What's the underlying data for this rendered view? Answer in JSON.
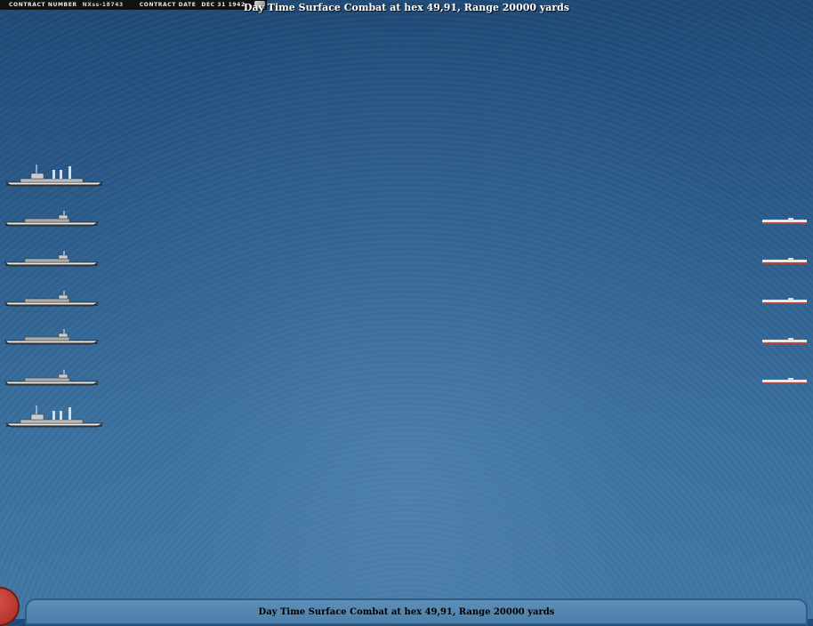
{
  "header": {
    "contract_number_label": "CONTRACT NUMBER",
    "contract_number_value": "NXss-18743",
    "contract_date_label": "CONTRACT DATE",
    "contract_date_value": "DEC 31 1942"
  },
  "combat": {
    "title": "Day Time Surface Combat at hex 49,91, Range 20000 yards"
  },
  "status_bar": {
    "text": "Day Time Surface Combat at hex 49,91, Range 20000 yards"
  },
  "allied_ships": [
    {
      "class": "cruiser"
    },
    {
      "class": "destroyer"
    },
    {
      "class": "destroyer"
    },
    {
      "class": "destroyer"
    },
    {
      "class": "destroyer"
    },
    {
      "class": "destroyer"
    },
    {
      "class": "cruiser"
    }
  ],
  "enemy_ships": [
    {
      "class": "transport"
    },
    {
      "class": "transport"
    },
    {
      "class": "transport"
    },
    {
      "class": "transport"
    },
    {
      "class": "transport"
    }
  ],
  "colors": {
    "sea": "#2b5d8d",
    "hull_allied": "#e6e6e6",
    "hull_enemy": "#b0473c"
  }
}
